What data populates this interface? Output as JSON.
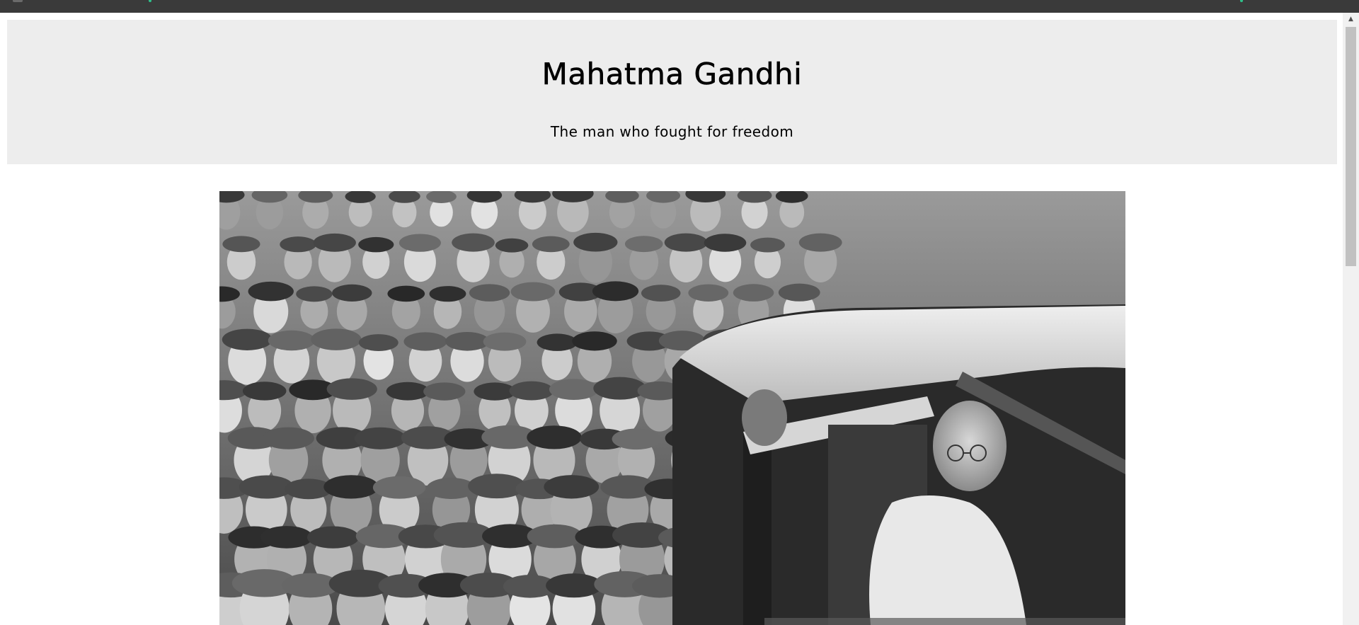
{
  "header": {
    "title": "Mahatma Gandhi",
    "subtitle": "The man who fought for freedom"
  },
  "image": {
    "description": "Black-and-white historical photograph of Mahatma Gandhi stepping out of a car surrounded by a large crowd"
  },
  "icons": {
    "scroll_up": "scroll-up-arrow-icon"
  },
  "colors": {
    "browser_bar": "#3a3a3a",
    "header_bg": "#ededed",
    "page_bg": "#ffffff",
    "scrollbar_track": "#f1f1f1",
    "scrollbar_thumb": "#c1c1c1"
  }
}
